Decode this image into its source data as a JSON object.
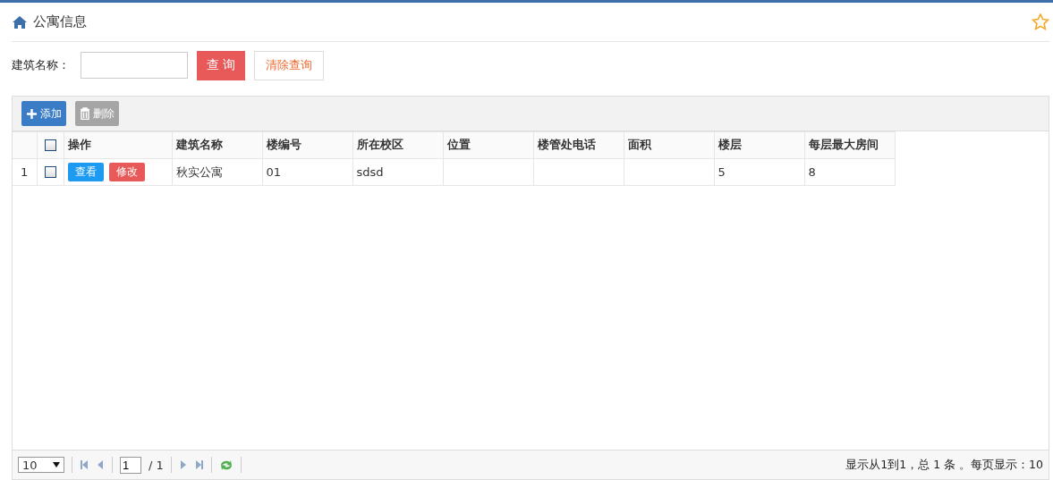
{
  "page": {
    "title": "公寓信息",
    "favorite": false
  },
  "filter": {
    "label": "建筑名称：",
    "search_button": "查 询",
    "clear_button": "清除查询"
  },
  "toolbar": [
    {
      "label": "添加",
      "kind": "add"
    },
    {
      "label": "删除",
      "kind": "delete"
    }
  ],
  "table": {
    "select_all": false,
    "columns": [
      "操作",
      "建筑名称",
      "楼编号",
      "所在校区",
      "位置",
      "楼管处电话",
      "面积",
      "楼层",
      "每层最大房间"
    ],
    "rows": [
      {
        "number": "1",
        "checked": false,
        "cells": [
          {
            "buttons": [
              "查看",
              "修改"
            ]
          },
          "秋实公寓",
          "01",
          "sdsd",
          "",
          "",
          "",
          "5",
          "8"
        ]
      }
    ]
  },
  "pager": {
    "page_size": "10",
    "page": "1",
    "total_pages": "/ 1",
    "summary": "显示从1到1，总 1 条 。每页显示：10"
  }
}
